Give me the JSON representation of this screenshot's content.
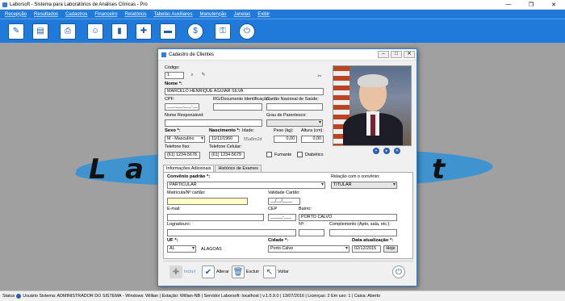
{
  "window": {
    "title": "Laborsoft - Sistema para Laboratórios de Análises Clínicas - Pro"
  },
  "menu": [
    "Recepção",
    "Resultados",
    "Cadastros",
    "Financeiro",
    "Relatórios",
    "Tabelas Auxiliares",
    "Manutenção",
    "Janelas",
    "Exibir"
  ],
  "toolbar": [
    "notepad-icon",
    "document-icon",
    "printer-icon",
    "people-icon",
    "book-icon",
    "syringe-icon",
    "car-icon",
    "money-icon",
    "lock-icon",
    "power-icon"
  ],
  "brand": {
    "letters": [
      "L",
      "a",
      "t"
    ]
  },
  "dialog": {
    "title": "Cadastro de Clientes",
    "codigo_label": "Código:",
    "codigo_value": "1",
    "nome_label": "Nome *:",
    "nome_value": "MARCELO HENRIQUE AGUIAR SILVA",
    "cpf_label": "CPF:",
    "cpf_value": "___.___.___-__",
    "rg_label": "RG/Documento Identificação:",
    "cns_label": "Cartão Nacional de Saúde:",
    "responsavel_label": "Nome Responsável:",
    "parentesco_label": "Grau de Parentesco:",
    "sexo_label": "Sexo *:",
    "sexo_value": "M - Masculino",
    "nascimento_label": "Nascimento *:",
    "nascimento_value": "11/11/1960",
    "idade_label": "Idade:",
    "idade_value": "55a8m2d",
    "peso_label": "Peso (kg):",
    "peso_value": "0,00",
    "altura_label": "Altura (cm):",
    "altura_value": "0,00",
    "fone_label": "Telefone fixo:",
    "fone_value": "(61) 1234-5678",
    "celular_label": "Telefone Celular:",
    "celular_value": "(61) 1234-5679",
    "fumante_label": "Fumante",
    "diabetico_label": "Diabético",
    "tabs": [
      "Informações Adicionais",
      "Histórico de Exames"
    ],
    "convenio_label": "Convênio padrão *:",
    "convenio_value": "PARTICULAR",
    "relacao_label": "Relação com o convênio:",
    "relacao_value": "TITULAR",
    "matricula_label": "Matrícula/Nº cartão:",
    "validade_label": "Validade Cartão:",
    "validade_value": "__/__/____",
    "email_label": "E-mail:",
    "cep_label": "CEP",
    "cep_value": "_____-___",
    "bairro_label": "Bairro:",
    "bairro_value": "PORTO CALVO",
    "logradouro_label": "Logradouro:",
    "numero_label": "Nº:",
    "complemento_label": "Complemento (Apto, sala, etc.):",
    "uf_label": "UF *:",
    "uf_value": "AL",
    "uf_name": "ALAGOAS",
    "cidade_label": "Cidade *:",
    "cidade_value": "Porto Calvo",
    "atualizacao_label": "Data atualização *:",
    "atualizacao_value": "02/12/2015",
    "hoje_label": "Hoje",
    "incluir_label": "Incluir",
    "alterar_label": "Alterar",
    "excluir_label": "Excluir",
    "voltar_label": "Voltar"
  },
  "status": {
    "status_label": "Status",
    "usuario": "Usuário Sistema: ADMINISTRADOR DO SISTEMA",
    "windows": "- Windows: Willian | Estação: Willian-NB",
    "servidor": "| Servidor Laborsoft: localhost",
    "versao": "v.1.5.9.0",
    "data": "13/07/2016",
    "licencas": "Licenças: 2",
    "em_uso": "Em uso: 1",
    "caixa": "Caixa: Aberto"
  },
  "colors": {
    "accent": "#1f7ad9",
    "brand_stripe": "#3f93cf"
  }
}
